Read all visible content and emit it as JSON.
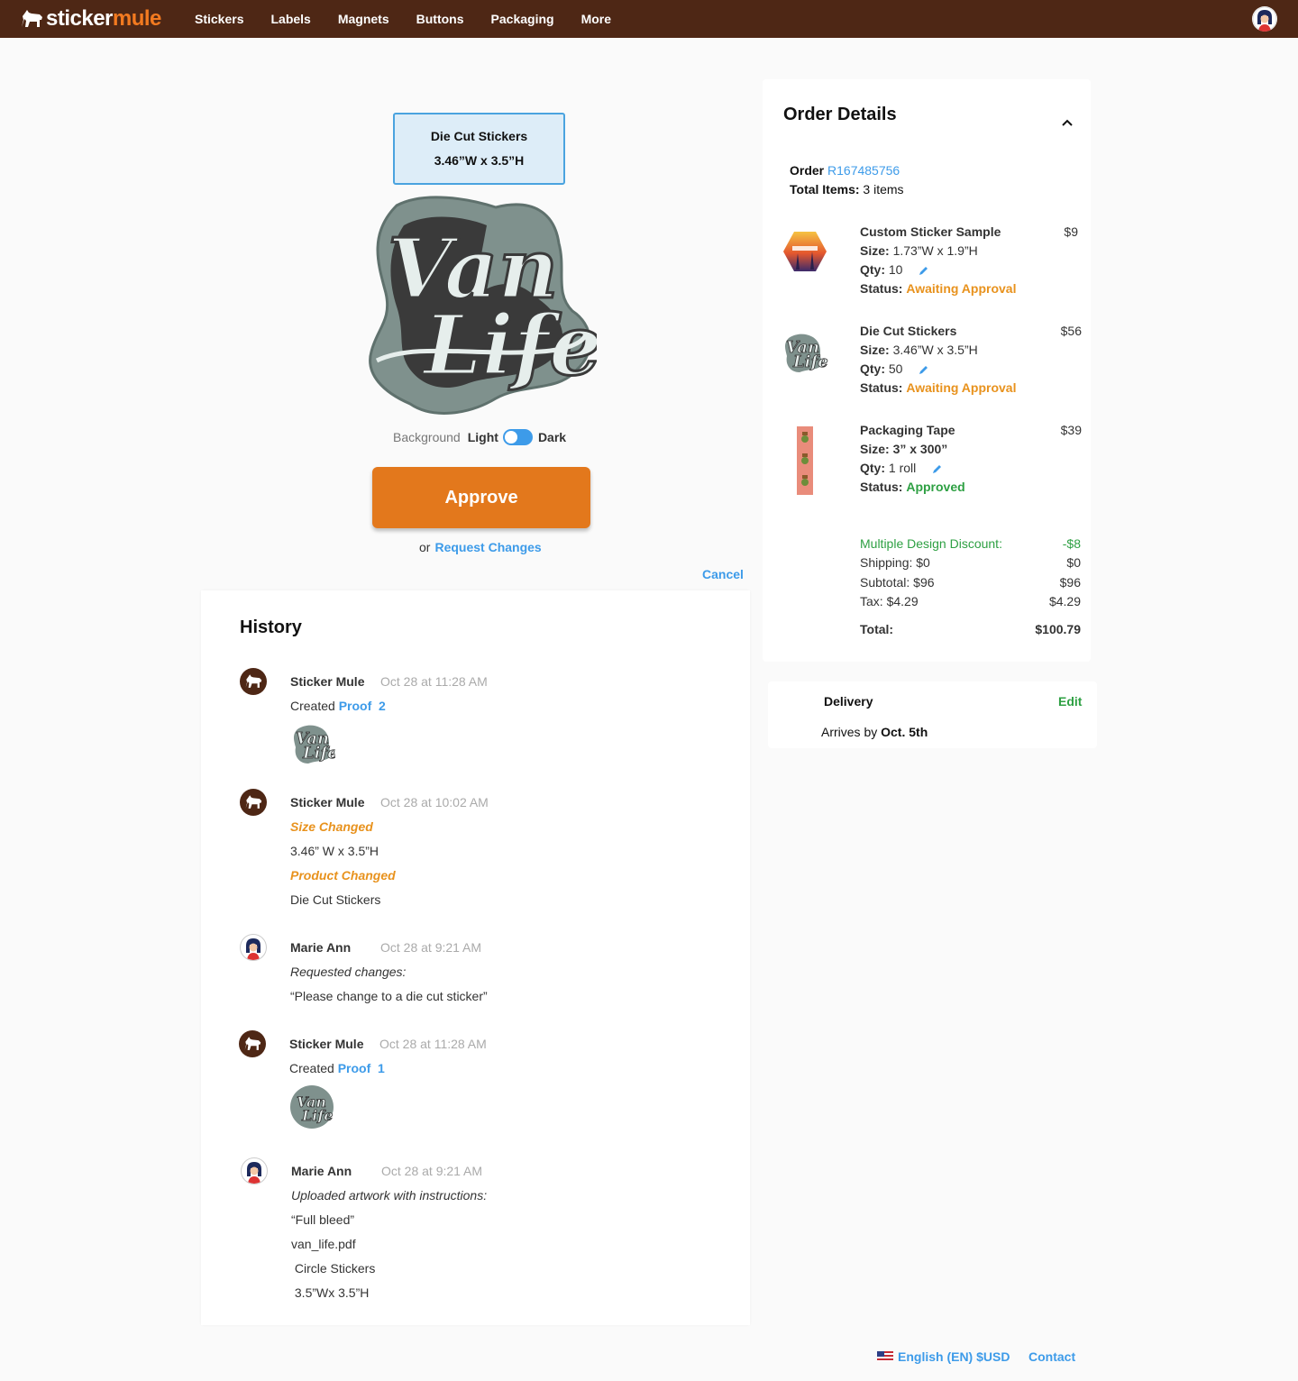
{
  "brand": {
    "part1": "sticker",
    "part2": "mule"
  },
  "nav": {
    "items": [
      "Stickers",
      "Labels",
      "Magnets",
      "Buttons",
      "Packaging",
      "More"
    ]
  },
  "product": {
    "name": "Die Cut Stickers",
    "size": "3.46”W x 3.5”H"
  },
  "background_toggle": {
    "label": "Background",
    "light": "Light",
    "dark": "Dark",
    "selected": "Dark"
  },
  "actions": {
    "approve": "Approve",
    "or": "or",
    "request_changes": "Request Changes",
    "cancel": "Cancel"
  },
  "history": {
    "title": "History",
    "entries": [
      {
        "author": "Sticker Mule",
        "time": "Oct 28 at 11:28 AM",
        "created": "Created",
        "proof_label": "Proof",
        "proof_num": "2"
      },
      {
        "author": "Sticker Mule",
        "time": "Oct 28 at 10:02 AM",
        "size_changed": "Size Changed",
        "size_value": "3.46” W x 3.5”H",
        "product_changed": "Product  Changed",
        "product_value": "Die Cut Stickers"
      },
      {
        "author": "Marie Ann",
        "time": "Oct 28 at 9:21 AM",
        "note": "Requested changes:",
        "message": "“Please change to a die cut sticker”"
      },
      {
        "author": "Sticker Mule",
        "time": "Oct 28 at 11:28 AM",
        "created": "Created",
        "proof_label": "Proof",
        "proof_num": "1"
      },
      {
        "author": "Marie Ann",
        "time": "Oct 28 at 9:21 AM",
        "note": "Uploaded artwork with instructions:",
        "line1": "“Full bleed”",
        "line2": "van_life.pdf",
        "line3": " Circle Stickers",
        "line4": " 3.5”Wx 3.5”H"
      }
    ]
  },
  "order": {
    "title": "Order Details",
    "order_label": "Order",
    "order_number": "R167485756",
    "total_items_label": "Total Items:",
    "total_items_value": "3 items",
    "size_label": "Size:",
    "qty_label": "Qty:",
    "status_label": "Status:",
    "items": [
      {
        "name": "Custom Sticker Sample",
        "price": "$9",
        "size": "1.73”W x 1.9”H",
        "qty": "10",
        "status": "Awaiting Approval"
      },
      {
        "name": "Die Cut Stickers",
        "price": "$56",
        "size": "3.46”W x 3.5”H",
        "qty": "50",
        "status": "Awaiting Approval"
      },
      {
        "name": "Packaging Tape",
        "price": "$39",
        "size": "3” x 300”",
        "qty": "1 roll",
        "status": "Approved"
      }
    ],
    "summary": {
      "discount_label": "Multiple Design Discount:",
      "discount_value": "-$8",
      "shipping_label": "Shipping: $0",
      "shipping_value": "$0",
      "subtotal_label": "Subtotal: $96",
      "subtotal_value": "$96",
      "tax_label": "Tax: $4.29",
      "tax_value": "$4.29",
      "total_label": "Total:",
      "total_value": "$100.79"
    }
  },
  "delivery": {
    "title": "Delivery",
    "edit": "Edit",
    "arrives_prefix": "Arrives by",
    "arrives_date": "Oct. 5th"
  },
  "footer": {
    "language": "English (EN) $USD",
    "contact": "Contact"
  },
  "colors": {
    "header": "#4e2715",
    "accent_orange": "#e3781c",
    "link_blue": "#3d9be9",
    "status_orange": "#e8921d",
    "status_green": "#2ea043"
  }
}
